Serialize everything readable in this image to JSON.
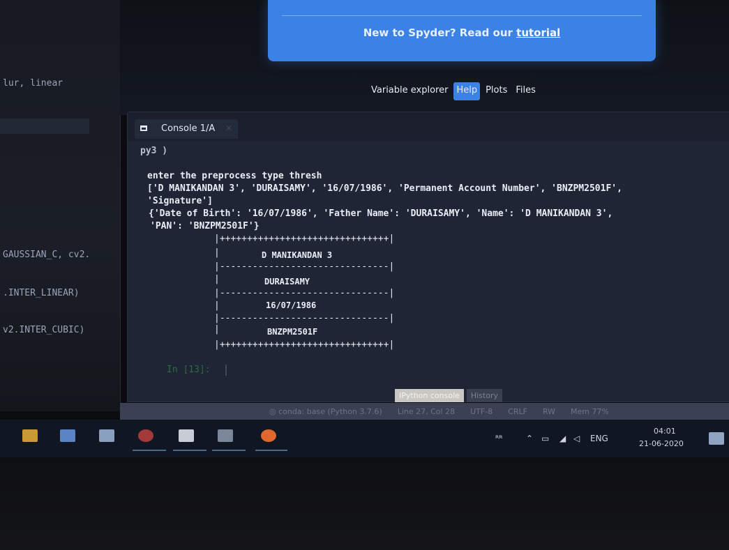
{
  "editor": {
    "snippets": [
      "lur, linear",
      "GAUSSIAN_C, cv2.",
      ".INTER_LINEAR)",
      "v2.INTER_CUBIC)"
    ]
  },
  "tour": {
    "message": "New to Spyder? Read our ",
    "link": "tutorial"
  },
  "pane_tabs": [
    "Variable explorer",
    "Help",
    "Plots",
    "Files"
  ],
  "console": {
    "tab_label": "Console 1/A",
    "lines": [
      "py3 )",
      "enter the preprocess type thresh",
      "['D MANIKANDAN 3', 'DURAISAMY', '16/07/1986', 'Permanent Account Number', 'BNZPM2501F',",
      "'Signature']",
      "{'Date of Birth': '16/07/1986', 'Father Name': 'DURAISAMY', 'Name': 'D MANIKANDAN 3',",
      "'PAN': 'BNZPM2501F'}"
    ],
    "box": {
      "top_border": "|+++++++++++++++++++++++++++++++|",
      "divider": "|-------------------------------|",
      "side": "|",
      "rows": [
        "D MANIKANDAN 3",
        "DURAISAMY",
        "16/07/1986",
        "BNZPM2501F"
      ],
      "bottom_border": "|+++++++++++++++++++++++++++++++|"
    },
    "prompt": "In [13]:"
  },
  "bottom_tabs": [
    "IPython console",
    "History"
  ],
  "statusbar": [
    "conda: base (Python 3.7.6)",
    "Line 27, Col 28",
    "UTF-8",
    "CRLF",
    "RW",
    "Mem 77%"
  ],
  "taskbar": {
    "tray": [
      "ENG"
    ],
    "time": "04:01",
    "date": "21-06-2020"
  }
}
